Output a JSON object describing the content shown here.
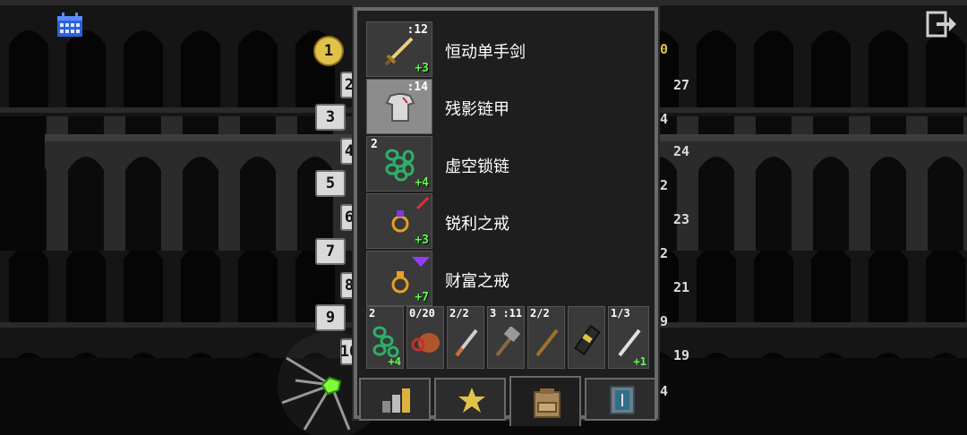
{
  "depth_markers": [
    "1",
    "2",
    "3",
    "4",
    "5",
    "6",
    "7",
    "8",
    "9",
    "10"
  ],
  "right_numbers": [
    "0",
    "27",
    "4",
    "24",
    "2",
    "23",
    "2",
    "21",
    "9",
    "19",
    "4"
  ],
  "equipment": [
    {
      "name": "恒动单手剑",
      "level": ":12",
      "bonus": "+3",
      "icon": "sword-icon"
    },
    {
      "name": "残影链甲",
      "level": ":14",
      "bonus": "",
      "icon": "armor-icon"
    },
    {
      "name": "虚空锁链",
      "level": "2",
      "bonus": "+4",
      "icon": "chains-icon"
    },
    {
      "name": "锐利之戒",
      "level": "",
      "bonus": "+3",
      "icon": "ring-icon"
    },
    {
      "name": "财富之戒",
      "level": "",
      "bonus": "+7",
      "icon": "ring-icon"
    }
  ],
  "quickslots": [
    {
      "text": "2",
      "bonus": "+4",
      "icon": "chains-icon"
    },
    {
      "text": "0/20",
      "bonus": "",
      "icon": "meat-icon"
    },
    {
      "text": "2/2",
      "bonus": "",
      "icon": "dart-icon"
    },
    {
      "text": "3 :11",
      "bonus": "",
      "icon": "hammer-icon"
    },
    {
      "text": "2/2",
      "bonus": "",
      "icon": "wand-icon"
    },
    {
      "text": "",
      "bonus": "",
      "icon": "scroll-icon"
    },
    {
      "text": "1/3",
      "bonus": "+1",
      "icon": "dagger-icon"
    }
  ],
  "tabs": [
    "stats-tab",
    "badges-tab",
    "inventory-tab",
    "journal-tab"
  ]
}
